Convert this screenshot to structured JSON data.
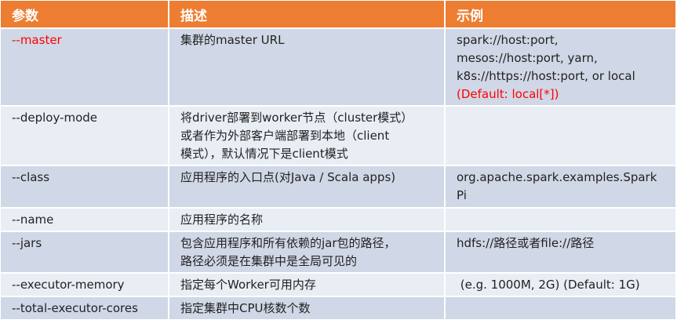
{
  "table": {
    "headers": [
      "参数",
      "描述",
      "示例"
    ],
    "rows": [
      {
        "param": "--master",
        "desc": [
          "集群的master URL"
        ],
        "example": [
          "spark://host:port,",
          "mesos://host:port, yarn,",
          "k8s://https://host:port, or local"
        ],
        "example_note": "(Default: local[*])"
      },
      {
        "param": "--deploy-mode",
        "desc": [
          "将driver部署到worker节点（cluster模式）",
          "或者作为外部客户端部署到本地（client",
          "模式），默认情况下是client模式"
        ],
        "example": []
      },
      {
        "param": "--class",
        "desc": [
          "应用程序的入口点(对Java / Scala apps)"
        ],
        "example": [
          "org.apache.spark.examples.Spark",
          "Pi"
        ]
      },
      {
        "param": "--name",
        "desc": [
          "应用程序的名称"
        ],
        "example": []
      },
      {
        "param": "--jars",
        "desc": [
          "包含应用程序和所有依赖的jar包的路径，",
          "路径必须是在集群中是全局可见的"
        ],
        "example": [
          "hdfs://路径或者file://路径"
        ]
      },
      {
        "param": "--executor-memory",
        "desc": [
          "指定每个Worker可用内存"
        ],
        "example": [
          " (e.g. 1000M, 2G) (Default: 1G)"
        ]
      },
      {
        "param": "--total-executor-cores",
        "desc": [
          "指定集群中CPU核数个数"
        ],
        "example": []
      }
    ]
  },
  "colors": {
    "header_bg": "#ed7d31",
    "header_text": "#ffffff",
    "row_dark": "#d0d7e6",
    "row_light": "#e9edf4",
    "highlight": "#ff0000"
  }
}
